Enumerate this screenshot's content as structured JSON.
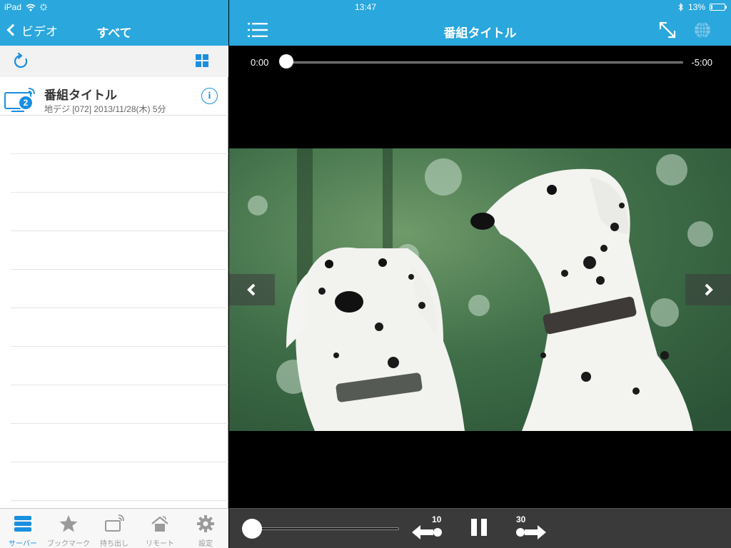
{
  "status_bar": {
    "device": "iPad",
    "time": "13:47",
    "battery_percent": "13%",
    "battery_level": 0.13
  },
  "left_panel": {
    "nav": {
      "back_label": "ビデオ",
      "title": "すべて"
    },
    "toolbar": {
      "refresh_icon": "refresh-icon",
      "view_toggle_icon": "grid-view-icon"
    },
    "items": [
      {
        "icon": "tv-wireless-icon",
        "badge": "2",
        "title": "番組タイトル",
        "subtitle": "地デジ [072] 2013/11/28(木)  5分"
      }
    ]
  },
  "tabbar": {
    "tabs": [
      {
        "label": "サーバー",
        "icon": "server-icon",
        "active": true
      },
      {
        "label": "ブックマーク",
        "icon": "star-icon",
        "active": false
      },
      {
        "label": "持ち出し",
        "icon": "carry-out-icon",
        "active": false
      },
      {
        "label": "リモート",
        "icon": "remote-home-icon",
        "active": false
      },
      {
        "label": "設定",
        "icon": "gear-icon",
        "active": false
      }
    ]
  },
  "player": {
    "title": "番組タイトル",
    "time_elapsed": "0:00",
    "time_remaining": "-5:00",
    "progress": 0.0,
    "skip_back_label": "10",
    "skip_forward_label": "30",
    "volume": 0.0
  },
  "colors": {
    "nav_blue": "#2aa7dc",
    "accent_blue": "#1a8fe0",
    "tab_inactive": "#9a9a9a",
    "controls_bg": "#3a3a3a"
  }
}
